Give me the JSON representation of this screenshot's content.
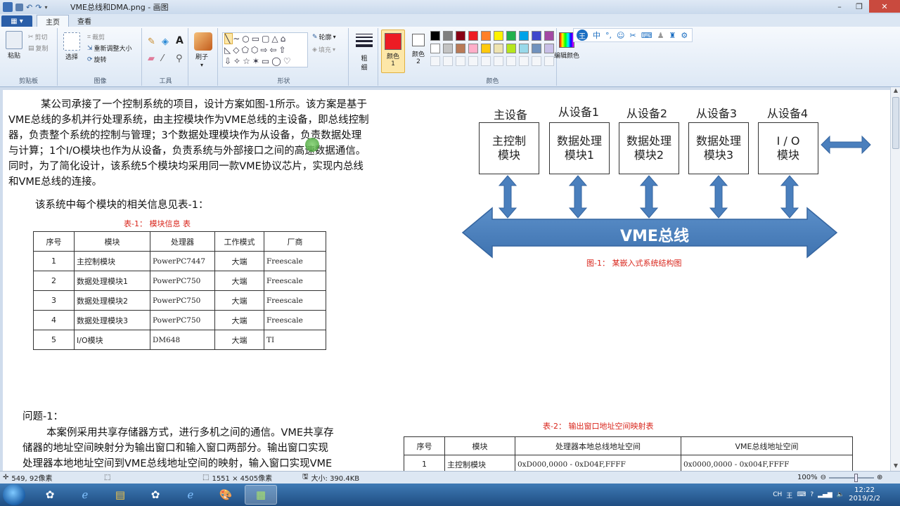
{
  "window": {
    "title": "VME总线和DMA.png - 画图"
  },
  "tabs": {
    "file": "▦ ▾",
    "home": "主页",
    "view": "查看"
  },
  "ribbon": {
    "clipboard": {
      "paste": "粘贴",
      "cut": "剪切",
      "copy": "复制",
      "label": "剪贴板"
    },
    "image": {
      "select": "选择",
      "crop": "裁剪",
      "resize": "重新调整大小",
      "rotate": "旋转",
      "label": "图像"
    },
    "tools": {
      "label": "工具"
    },
    "brush": {
      "label": "刷子"
    },
    "shapes": {
      "outline": "轮廓",
      "fill": "填充",
      "label": "形状"
    },
    "size": {
      "label": "粗细"
    },
    "color1": {
      "label": "颜色 1"
    },
    "color2": {
      "label": "颜色 2"
    },
    "colors": {
      "label": "颜色",
      "edit": "编辑颜色"
    },
    "palette_row1": [
      "#000000",
      "#7f7f7f",
      "#880015",
      "#ed1c24",
      "#ff7f27",
      "#fff200",
      "#22b14c",
      "#00a2e8",
      "#3f48cc",
      "#a349a4"
    ],
    "palette_row2": [
      "#ffffff",
      "#c3c3c3",
      "#b97a57",
      "#ffaec9",
      "#ffc90e",
      "#efe4b0",
      "#b5e61d",
      "#99d9ea",
      "#7092be",
      "#c8bfe7"
    ],
    "ime": {
      "logo": "王",
      "lang": "中"
    }
  },
  "doc": {
    "para1": [
      "某公司承接了一个控制系统的项目，设计方案如图-1所示。该方案是基于",
      "VME总线的多机并行处理系统，由主控模块作为VME总线的主设备，即总线控制",
      "器，负责整个系统的控制与管理；3个数据处理模块作为从设备，负责数据处理",
      "与计算；1个I/O模块也作为从设备，负责系统与外部接口之间的高速数据通信。",
      "同时，为了简化设计，该系统5个模块均采用同一款VME协议芯片，实现内总线",
      "和VME总线的连接。"
    ],
    "para2": "该系统中每个模块的相关信息见表-1：",
    "table1_caption": "表-1：   模块信息 表",
    "table1": {
      "headers": [
        "序号",
        "模块",
        "处理器",
        "工作模式",
        "厂商"
      ],
      "rows": [
        [
          "1",
          "主控制模块",
          "PowerPC7447",
          "大端",
          "Freescale"
        ],
        [
          "2",
          "数据处理模块1",
          "PowerPC750",
          "大端",
          "Freescale"
        ],
        [
          "3",
          "数据处理模块2",
          "PowerPC750",
          "大端",
          "Freescale"
        ],
        [
          "4",
          "数据处理模块3",
          "PowerPC750",
          "大端",
          "Freescale"
        ],
        [
          "5",
          "I/O模块",
          "DM648",
          "大端",
          "TI"
        ]
      ]
    },
    "diagram": {
      "labels": [
        "主设备",
        "从设备1",
        "从设备2",
        "从设备3",
        "从设备4"
      ],
      "boxes": [
        [
          "主控制",
          "模块"
        ],
        [
          "数据处理",
          "模块1"
        ],
        [
          "数据处理",
          "模块2"
        ],
        [
          "数据处理",
          "模块3"
        ],
        [
          "I / O",
          "模块"
        ]
      ],
      "bus": "VME总线",
      "caption": "图-1：   某嵌入式系统结构图"
    },
    "question_title": "问题-1：",
    "question_lines": [
      "本案例采用共享存储器方式，进行多机之间的通信。VME共享存",
      "储器的地址空间映射分为输出窗口和输入窗口两部分。输出窗口实现",
      "处理器本地地址空间到VME总线地址空间的映射，输入窗口实现VME"
    ],
    "table2_caption": "表-2：   输出窗口地址空间映射表",
    "table2": {
      "headers": [
        "序号",
        "模块",
        "处理器本地总线地址空间",
        "VME总线地址空间"
      ],
      "rows": [
        [
          "1",
          "主控制模块",
          "0xD000,0000 - 0xD04F,FFFF",
          "0x0000,0000 - 0x004F,FFFF"
        ]
      ]
    }
  },
  "status": {
    "cursor": "549, 92像素",
    "dimensions": "1551 × 4505像素",
    "size": "大小: 390.4KB",
    "zoom": "100%"
  },
  "taskbar": {
    "ime": "CH",
    "time": "12:22",
    "date": "2019/2/2"
  }
}
